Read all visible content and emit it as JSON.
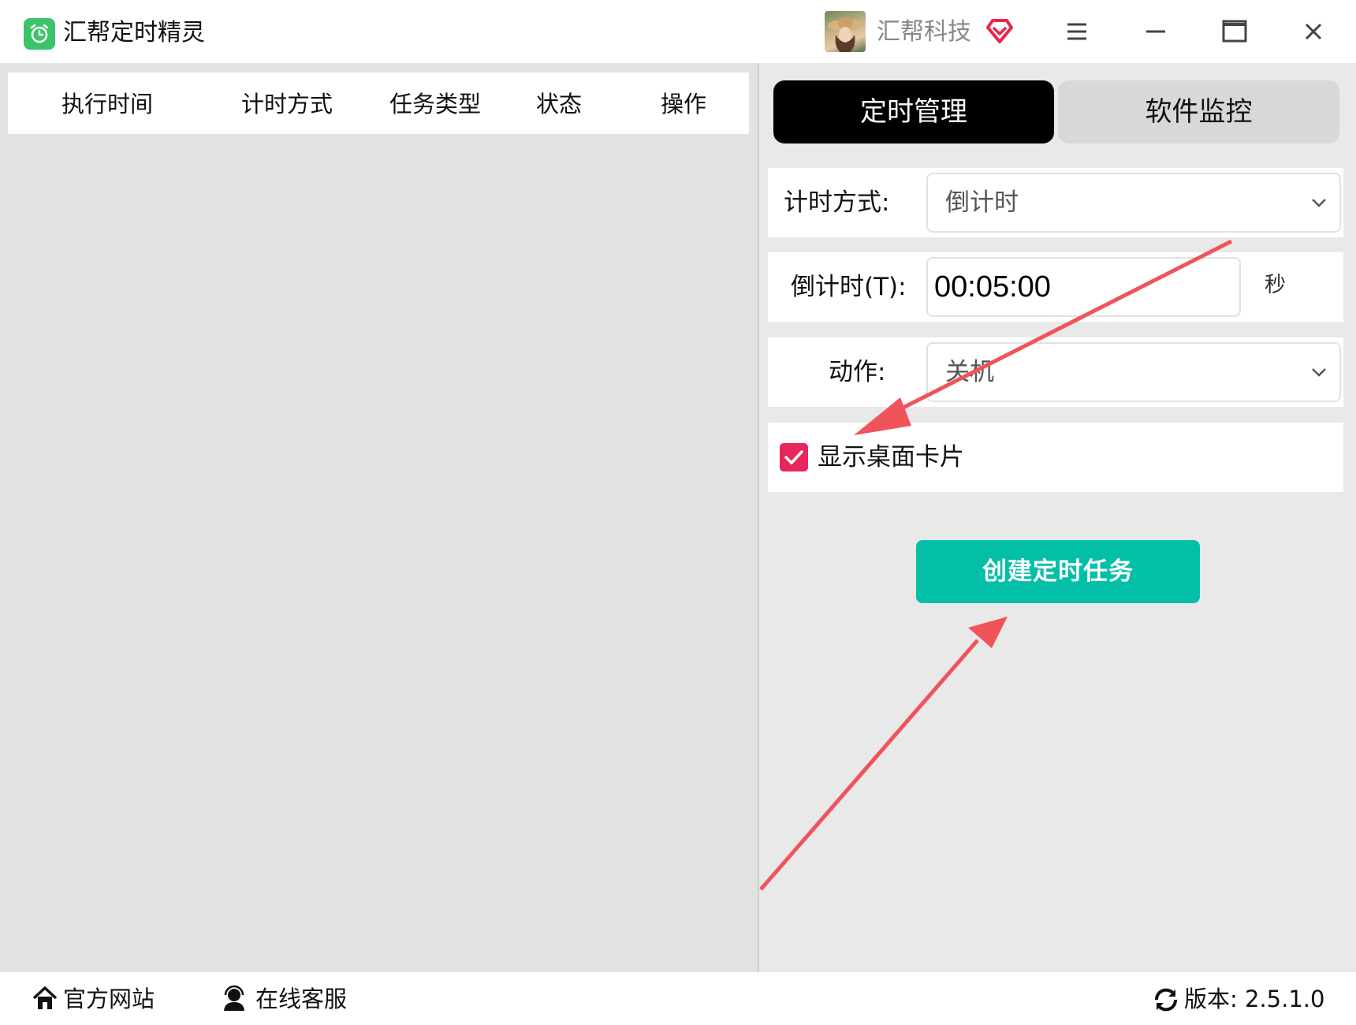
{
  "app": {
    "title": "汇帮定时精灵"
  },
  "user": {
    "name": "汇帮科技"
  },
  "window_controls": [
    "menu",
    "minimize",
    "maximize",
    "close"
  ],
  "task_table": {
    "columns": [
      "执行时间",
      "计时方式",
      "任务类型",
      "状态",
      "操作"
    ],
    "rows": []
  },
  "tabs": [
    {
      "label": "定时管理",
      "active": true
    },
    {
      "label": "软件监控",
      "active": false
    }
  ],
  "form": {
    "timing_mode": {
      "label": "计时方式:",
      "value": "倒计时"
    },
    "countdown": {
      "label": "倒计时(T):",
      "value": "00:05:00",
      "unit": "秒"
    },
    "action": {
      "label": "动作:",
      "value": "关机"
    },
    "show_desktop_card": {
      "label": "显示桌面卡片",
      "checked": true
    },
    "create_button": "创建定时任务"
  },
  "statusbar": {
    "website": "官方网站",
    "support": "在线客服",
    "version": "版本: 2.5.1.0"
  },
  "colors": {
    "accent_green": "#04bfa8",
    "checkbox_pink": "#e8265d",
    "tab_active": "#000000",
    "annotation_arrow": "#f0535a"
  }
}
